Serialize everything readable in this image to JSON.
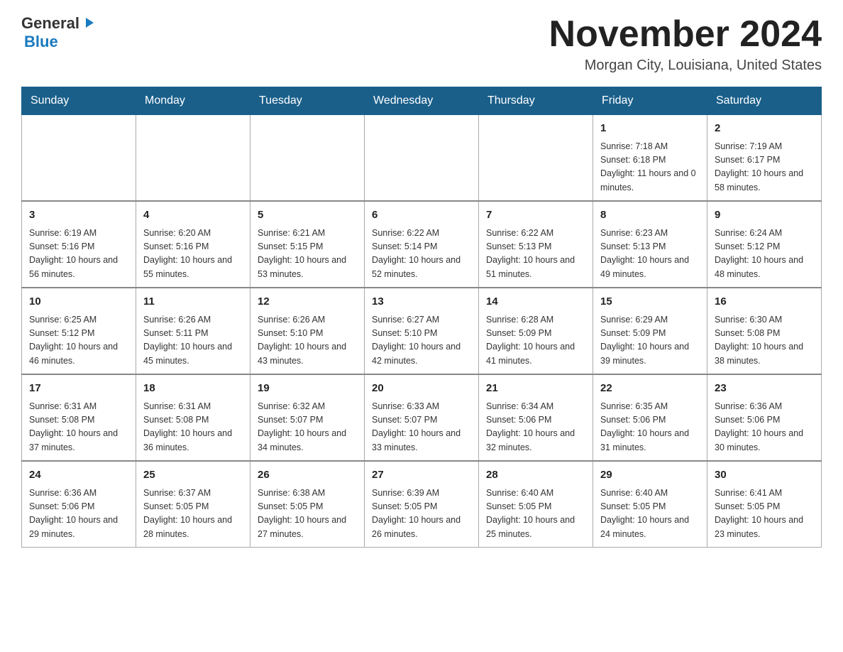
{
  "header": {
    "logo": {
      "general": "General",
      "blue_triangle": "▶",
      "blue": "Blue"
    },
    "title": "November 2024",
    "subtitle": "Morgan City, Louisiana, United States"
  },
  "calendar": {
    "days_of_week": [
      "Sunday",
      "Monday",
      "Tuesday",
      "Wednesday",
      "Thursday",
      "Friday",
      "Saturday"
    ],
    "weeks": [
      {
        "days": [
          {
            "num": "",
            "info": ""
          },
          {
            "num": "",
            "info": ""
          },
          {
            "num": "",
            "info": ""
          },
          {
            "num": "",
            "info": ""
          },
          {
            "num": "",
            "info": ""
          },
          {
            "num": "1",
            "info": "Sunrise: 7:18 AM\nSunset: 6:18 PM\nDaylight: 11 hours and 0 minutes."
          },
          {
            "num": "2",
            "info": "Sunrise: 7:19 AM\nSunset: 6:17 PM\nDaylight: 10 hours and 58 minutes."
          }
        ]
      },
      {
        "days": [
          {
            "num": "3",
            "info": "Sunrise: 6:19 AM\nSunset: 5:16 PM\nDaylight: 10 hours and 56 minutes."
          },
          {
            "num": "4",
            "info": "Sunrise: 6:20 AM\nSunset: 5:16 PM\nDaylight: 10 hours and 55 minutes."
          },
          {
            "num": "5",
            "info": "Sunrise: 6:21 AM\nSunset: 5:15 PM\nDaylight: 10 hours and 53 minutes."
          },
          {
            "num": "6",
            "info": "Sunrise: 6:22 AM\nSunset: 5:14 PM\nDaylight: 10 hours and 52 minutes."
          },
          {
            "num": "7",
            "info": "Sunrise: 6:22 AM\nSunset: 5:13 PM\nDaylight: 10 hours and 51 minutes."
          },
          {
            "num": "8",
            "info": "Sunrise: 6:23 AM\nSunset: 5:13 PM\nDaylight: 10 hours and 49 minutes."
          },
          {
            "num": "9",
            "info": "Sunrise: 6:24 AM\nSunset: 5:12 PM\nDaylight: 10 hours and 48 minutes."
          }
        ]
      },
      {
        "days": [
          {
            "num": "10",
            "info": "Sunrise: 6:25 AM\nSunset: 5:12 PM\nDaylight: 10 hours and 46 minutes."
          },
          {
            "num": "11",
            "info": "Sunrise: 6:26 AM\nSunset: 5:11 PM\nDaylight: 10 hours and 45 minutes."
          },
          {
            "num": "12",
            "info": "Sunrise: 6:26 AM\nSunset: 5:10 PM\nDaylight: 10 hours and 43 minutes."
          },
          {
            "num": "13",
            "info": "Sunrise: 6:27 AM\nSunset: 5:10 PM\nDaylight: 10 hours and 42 minutes."
          },
          {
            "num": "14",
            "info": "Sunrise: 6:28 AM\nSunset: 5:09 PM\nDaylight: 10 hours and 41 minutes."
          },
          {
            "num": "15",
            "info": "Sunrise: 6:29 AM\nSunset: 5:09 PM\nDaylight: 10 hours and 39 minutes."
          },
          {
            "num": "16",
            "info": "Sunrise: 6:30 AM\nSunset: 5:08 PM\nDaylight: 10 hours and 38 minutes."
          }
        ]
      },
      {
        "days": [
          {
            "num": "17",
            "info": "Sunrise: 6:31 AM\nSunset: 5:08 PM\nDaylight: 10 hours and 37 minutes."
          },
          {
            "num": "18",
            "info": "Sunrise: 6:31 AM\nSunset: 5:08 PM\nDaylight: 10 hours and 36 minutes."
          },
          {
            "num": "19",
            "info": "Sunrise: 6:32 AM\nSunset: 5:07 PM\nDaylight: 10 hours and 34 minutes."
          },
          {
            "num": "20",
            "info": "Sunrise: 6:33 AM\nSunset: 5:07 PM\nDaylight: 10 hours and 33 minutes."
          },
          {
            "num": "21",
            "info": "Sunrise: 6:34 AM\nSunset: 5:06 PM\nDaylight: 10 hours and 32 minutes."
          },
          {
            "num": "22",
            "info": "Sunrise: 6:35 AM\nSunset: 5:06 PM\nDaylight: 10 hours and 31 minutes."
          },
          {
            "num": "23",
            "info": "Sunrise: 6:36 AM\nSunset: 5:06 PM\nDaylight: 10 hours and 30 minutes."
          }
        ]
      },
      {
        "days": [
          {
            "num": "24",
            "info": "Sunrise: 6:36 AM\nSunset: 5:06 PM\nDaylight: 10 hours and 29 minutes."
          },
          {
            "num": "25",
            "info": "Sunrise: 6:37 AM\nSunset: 5:05 PM\nDaylight: 10 hours and 28 minutes."
          },
          {
            "num": "26",
            "info": "Sunrise: 6:38 AM\nSunset: 5:05 PM\nDaylight: 10 hours and 27 minutes."
          },
          {
            "num": "27",
            "info": "Sunrise: 6:39 AM\nSunset: 5:05 PM\nDaylight: 10 hours and 26 minutes."
          },
          {
            "num": "28",
            "info": "Sunrise: 6:40 AM\nSunset: 5:05 PM\nDaylight: 10 hours and 25 minutes."
          },
          {
            "num": "29",
            "info": "Sunrise: 6:40 AM\nSunset: 5:05 PM\nDaylight: 10 hours and 24 minutes."
          },
          {
            "num": "30",
            "info": "Sunrise: 6:41 AM\nSunset: 5:05 PM\nDaylight: 10 hours and 23 minutes."
          }
        ]
      }
    ]
  }
}
